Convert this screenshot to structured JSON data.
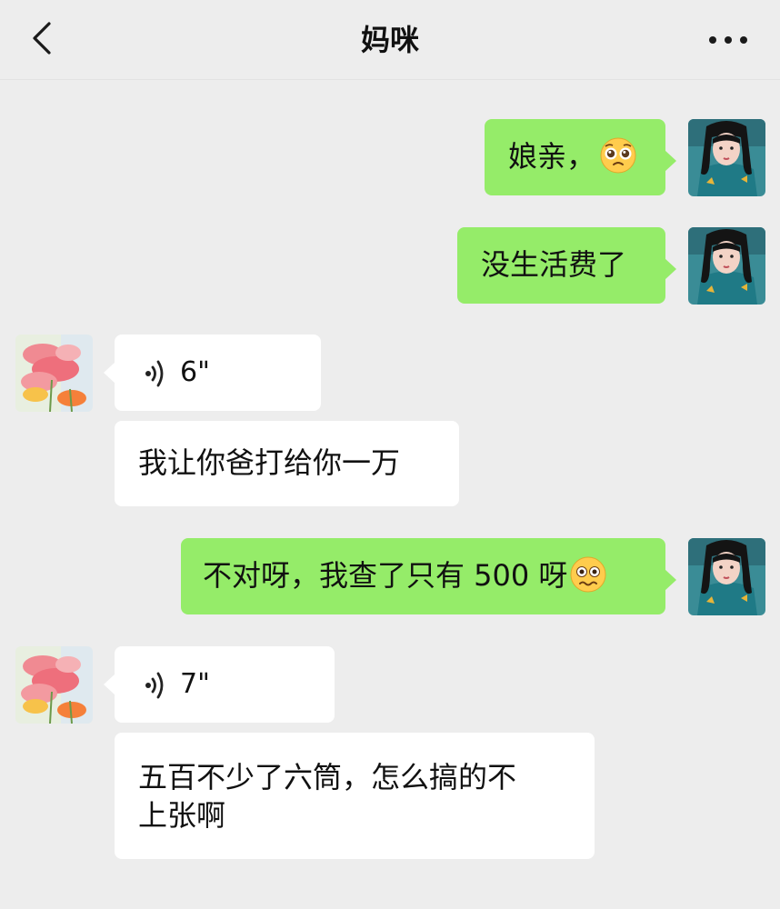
{
  "header": {
    "title": "妈咪",
    "back_icon": "chevron-left-icon",
    "more_icon": "more-dots-icon"
  },
  "colors": {
    "background": "#ededed",
    "sent_bubble": "#95ec69",
    "received_bubble": "#ffffff"
  },
  "messages": [
    {
      "sender": "me",
      "type": "text",
      "text": "娘亲，",
      "emoji": "pleading-face-icon"
    },
    {
      "sender": "me",
      "type": "text",
      "text": "没生活费了"
    },
    {
      "sender": "mom",
      "type": "voice",
      "duration": "6\""
    },
    {
      "sender": "mom",
      "type": "text",
      "text": "我让你爸打给你一万"
    },
    {
      "sender": "me",
      "type": "text",
      "text": "不对呀，我查了只有 500 呀",
      "emoji": "woozy-face-icon"
    },
    {
      "sender": "mom",
      "type": "voice",
      "duration": "7\""
    },
    {
      "sender": "mom",
      "type": "text",
      "text_line1": "五百不少了六筒，怎么搞的不",
      "text_line2": "上张啊"
    }
  ]
}
